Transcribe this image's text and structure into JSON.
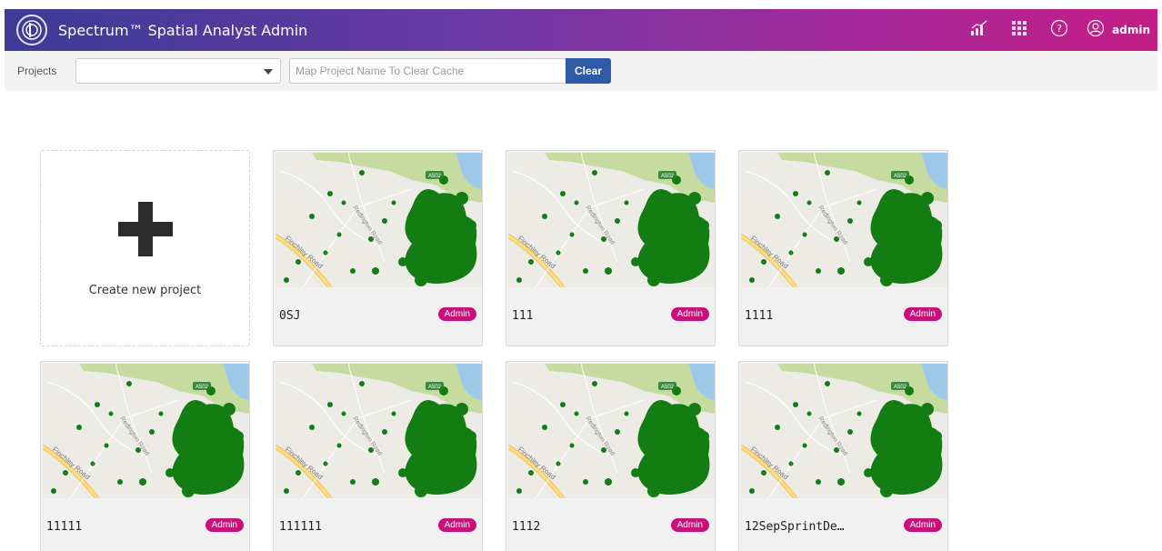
{
  "app": {
    "title": "Spectrum™ Spatial Analyst Admin",
    "user": "admin",
    "colors": {
      "gradient_start": "#3b3b95",
      "gradient_end": "#c41d86",
      "badge": "#c8107a",
      "clear_button": "#2f5aa8"
    }
  },
  "toolbar": {
    "projects_label": "Projects",
    "project_select_value": "",
    "cache_placeholder": "Map Project Name To Clear Cache",
    "clear_label": "Clear"
  },
  "create": {
    "label": "Create new project"
  },
  "map_labels": {
    "road1": "Finchley Road",
    "road2": "Redington Road",
    "shield": "A502"
  },
  "projects": [
    {
      "name": "0SJ",
      "badge": "Admin"
    },
    {
      "name": "111",
      "badge": "Admin"
    },
    {
      "name": "1111",
      "badge": "Admin"
    },
    {
      "name": "11111",
      "badge": "Admin"
    },
    {
      "name": "111111",
      "badge": "Admin"
    },
    {
      "name": "1112",
      "badge": "Admin"
    },
    {
      "name": "12SepSprintDe…",
      "badge": "Admin"
    }
  ]
}
